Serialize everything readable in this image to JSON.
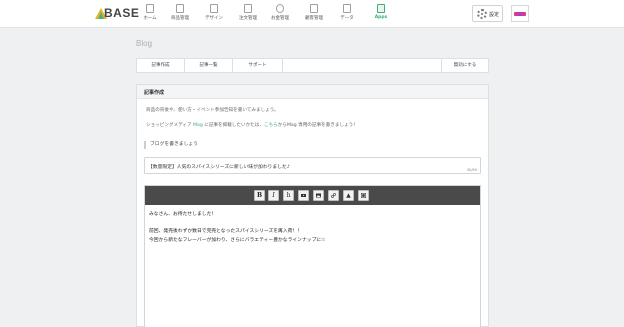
{
  "brand": {
    "logo_text": "BASE"
  },
  "nav": [
    {
      "label": "ホーム",
      "icon": "home-icon"
    },
    {
      "label": "商品管理",
      "icon": "products-icon"
    },
    {
      "label": "デザイン",
      "icon": "design-icon"
    },
    {
      "label": "注文管理",
      "icon": "orders-icon"
    },
    {
      "label": "お金管理",
      "icon": "money-icon"
    },
    {
      "label": "顧客管理",
      "icon": "customers-icon"
    },
    {
      "label": "データ",
      "icon": "data-icon"
    },
    {
      "label": "Apps",
      "icon": "apps-icon",
      "active": true
    }
  ],
  "header": {
    "settings_label": "設定"
  },
  "page": {
    "title": "Blog"
  },
  "tabs": [
    {
      "label": "記事作成"
    },
    {
      "label": "記事一覧"
    },
    {
      "label": "サポート"
    },
    {
      "label": "無効にする"
    }
  ],
  "panel": {
    "title": "記事作成",
    "intro_line1": "商品の背後や、使い方・イベント参加告知を書いてみましょう。",
    "intro_line2_pre": "ショッピングメディア ",
    "intro_line2_link1": "Mag",
    "intro_line2_mid": " に記事を掲載したいかたは、",
    "intro_line2_link2": "こちら",
    "intro_line2_post": "からMag 専用の記事を書きましょう！",
    "section_label": "ブログを書きましょう",
    "title_value": "【数量限定】人気のスパイスシリーズに新しい味が加わりました♪",
    "title_counter": "30/60",
    "body_lines": [
      "みなさん、お待たせしました！",
      "前回、発売後わずか数日で完売となったスパイスシリーズを再入荷！！",
      "今回から新たなフレーバーが加わり、さらにバラエティー豊かなラインナップに☆"
    ]
  },
  "toolbar": {
    "bold": "B",
    "italic": "I",
    "heading": "h"
  },
  "colors": {
    "accent": "#3fae74",
    "toolbar_bg": "#4a4a4a",
    "background": "#eef0f2"
  }
}
